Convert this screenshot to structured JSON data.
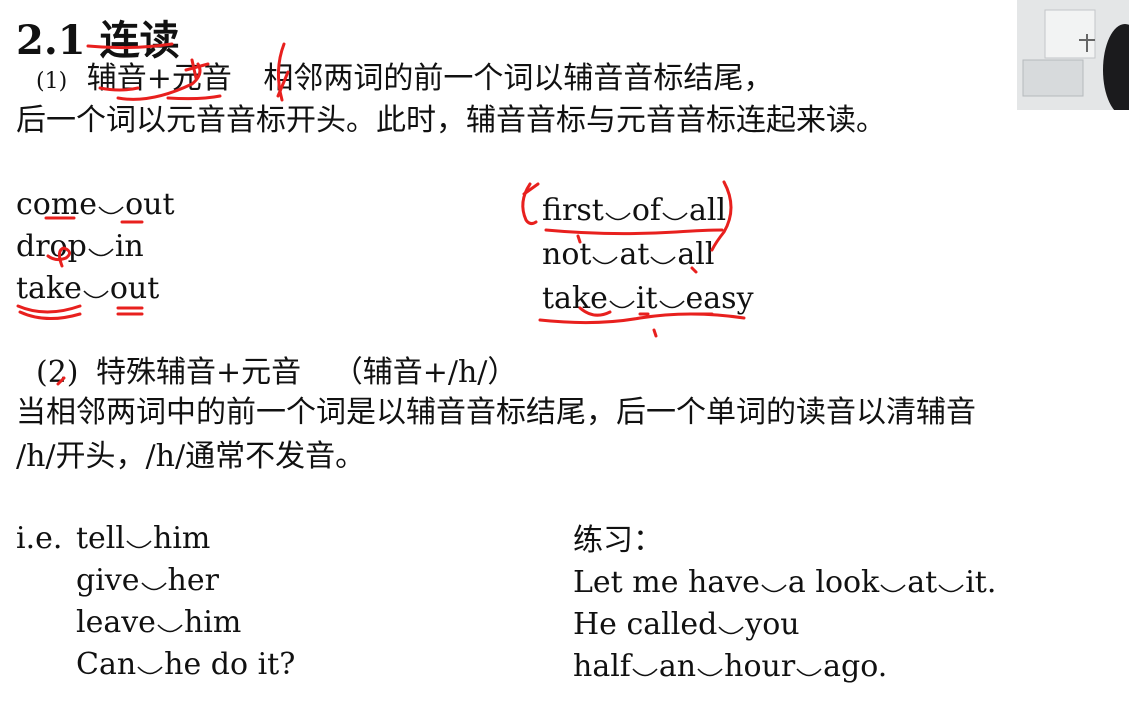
{
  "title": {
    "number": "2.1",
    "text": "连读"
  },
  "section1": {
    "label": "(1)",
    "heading": "辅音+元音",
    "desc_a": "相邻两词的前一个词以辅音音标结尾，",
    "desc_b": "后一个词以元音音标开头。此时，辅音音标与元音音标连起来读。",
    "examples_left": [
      [
        "come",
        "out"
      ],
      [
        "drop",
        "in"
      ],
      [
        "take",
        "out"
      ]
    ],
    "examples_right": [
      [
        "first",
        "of",
        "all"
      ],
      [
        "not",
        "at",
        "all"
      ],
      [
        "take",
        "it",
        "easy"
      ]
    ]
  },
  "section2": {
    "label": "(2)",
    "heading": "特殊辅音+元音",
    "note": "（辅音+/h/）",
    "desc_a": "当相邻两词中的前一个词是以辅音音标结尾，后一个单词的读音以清辅音",
    "desc_b": "/h/开头，/h/通常不发音。",
    "ie_label": "i.e.",
    "examples": [
      [
        "tell",
        "him"
      ],
      [
        "give",
        "her"
      ],
      [
        "leave",
        "him"
      ],
      [
        "Can",
        "he do it?"
      ]
    ],
    "practice_label": "练习：",
    "practice": [
      [
        "Let me have",
        "a look",
        "at",
        "it."
      ],
      [
        "He called",
        "you"
      ],
      [
        "half",
        "an",
        "hour",
        "ago."
      ]
    ]
  },
  "colors": {
    "annotation": "#e8201e",
    "text": "#111111"
  }
}
